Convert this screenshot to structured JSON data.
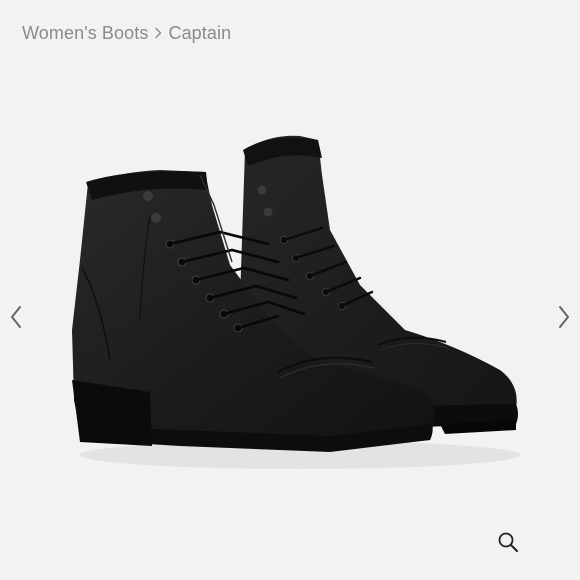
{
  "breadcrumb": {
    "parent": "Women's Boots",
    "current": "Captain"
  },
  "gallery": {
    "image_alt": "Black leather cap-toe lace-up boots, side and three-quarter view",
    "prev_icon": "chevron-left-icon",
    "next_icon": "chevron-right-icon",
    "zoom_icon": "magnifier-icon"
  },
  "colors": {
    "background": "#f2f2f1",
    "text_muted": "#8a8a8a",
    "leather": "#1b1b1b",
    "sole": "#0e0e0e",
    "arrow": "#666666"
  }
}
